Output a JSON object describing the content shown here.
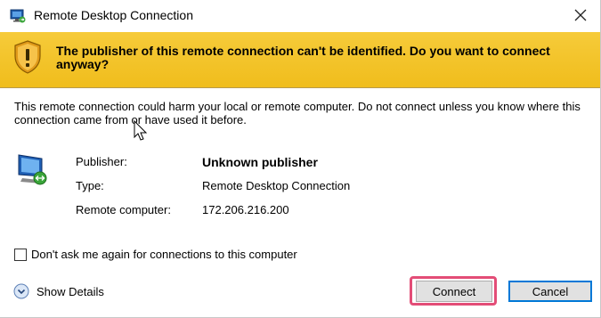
{
  "window": {
    "title": "Remote Desktop Connection",
    "close_symbol": "✕"
  },
  "banner": {
    "message": "The publisher of this remote connection can't be identified. Do you want to connect anyway?",
    "icon": "shield-warning-icon",
    "color": "#f2c12e"
  },
  "description": "This remote connection could harm your local or remote computer. Do not connect unless you know where this connection came from or have used it before.",
  "details": {
    "icon": "remote-monitor-icon",
    "rows": [
      {
        "label": "Publisher:",
        "value": "Unknown publisher"
      },
      {
        "label": "Type:",
        "value": "Remote Desktop Connection"
      },
      {
        "label": "Remote computer:",
        "value": "172.206.216.200"
      }
    ]
  },
  "checkbox": {
    "label": "Don't ask me again for connections to this computer",
    "checked": false
  },
  "show_details": {
    "label": "Show Details",
    "icon": "chevron-down-circle-icon"
  },
  "buttons": {
    "connect": "Connect",
    "cancel": "Cancel"
  },
  "highlight_color": "#e34d77"
}
